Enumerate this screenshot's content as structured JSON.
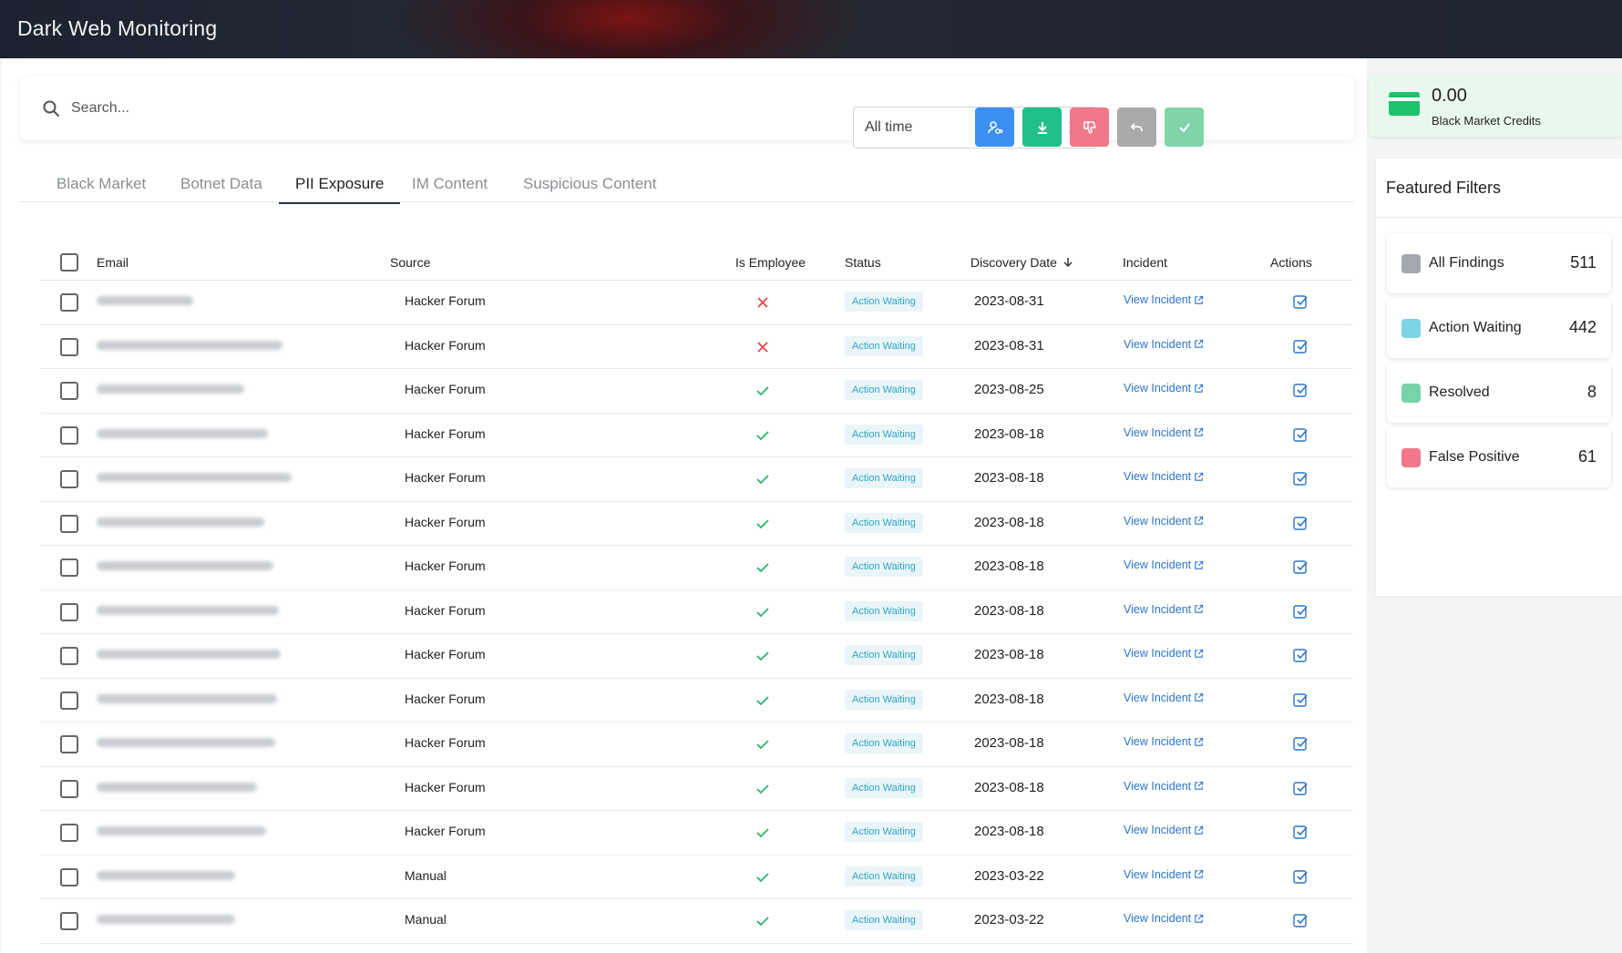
{
  "app": {
    "title": "Dark Web Monitoring"
  },
  "search": {
    "placeholder": "Search..."
  },
  "date_filter": {
    "value": "All time"
  },
  "toolbar": {
    "buttons": [
      {
        "name": "assign-button",
        "icon": "user-link-icon",
        "color": "#3b8ff3"
      },
      {
        "name": "download-button",
        "icon": "download-icon",
        "color": "#21c08b"
      },
      {
        "name": "false-positive-button",
        "icon": "thumbs-down-icon",
        "color": "#f0788a"
      },
      {
        "name": "undo-button",
        "icon": "undo-icon",
        "color": "#a9aaab"
      },
      {
        "name": "resolve-button",
        "icon": "check-icon",
        "color": "#7fd4a8"
      }
    ]
  },
  "tabs": [
    "Black Market",
    "Botnet Data",
    "PII Exposure",
    "IM Content",
    "Suspicious Content"
  ],
  "active_tab": "PII Exposure",
  "table": {
    "columns": [
      "Email",
      "Source",
      "Is Employee",
      "Status",
      "Discovery Date",
      "Incident",
      "Actions"
    ],
    "incident_link_label": "View Incident",
    "rows": [
      {
        "source": "Hacker Forum",
        "is_employee": false,
        "status": "Action Waiting",
        "date": "2023-08-31"
      },
      {
        "source": "Hacker Forum",
        "is_employee": false,
        "status": "Action Waiting",
        "date": "2023-08-31"
      },
      {
        "source": "Hacker Forum",
        "is_employee": true,
        "status": "Action Waiting",
        "date": "2023-08-25"
      },
      {
        "source": "Hacker Forum",
        "is_employee": true,
        "status": "Action Waiting",
        "date": "2023-08-18"
      },
      {
        "source": "Hacker Forum",
        "is_employee": true,
        "status": "Action Waiting",
        "date": "2023-08-18"
      },
      {
        "source": "Hacker Forum",
        "is_employee": true,
        "status": "Action Waiting",
        "date": "2023-08-18"
      },
      {
        "source": "Hacker Forum",
        "is_employee": true,
        "status": "Action Waiting",
        "date": "2023-08-18"
      },
      {
        "source": "Hacker Forum",
        "is_employee": true,
        "status": "Action Waiting",
        "date": "2023-08-18"
      },
      {
        "source": "Hacker Forum",
        "is_employee": true,
        "status": "Action Waiting",
        "date": "2023-08-18"
      },
      {
        "source": "Hacker Forum",
        "is_employee": true,
        "status": "Action Waiting",
        "date": "2023-08-18"
      },
      {
        "source": "Hacker Forum",
        "is_employee": true,
        "status": "Action Waiting",
        "date": "2023-08-18"
      },
      {
        "source": "Hacker Forum",
        "is_employee": true,
        "status": "Action Waiting",
        "date": "2023-08-18"
      },
      {
        "source": "Hacker Forum",
        "is_employee": true,
        "status": "Action Waiting",
        "date": "2023-08-18"
      },
      {
        "source": "Manual",
        "is_employee": true,
        "status": "Action Waiting",
        "date": "2023-03-22"
      },
      {
        "source": "Manual",
        "is_employee": true,
        "status": "Action Waiting",
        "date": "2023-03-22"
      }
    ]
  },
  "credits": {
    "amount": "0.00",
    "label": "Black Market Credits",
    "color": "#1ec36d"
  },
  "featured_filters": {
    "title": "Featured Filters",
    "items": [
      {
        "label": "All Findings",
        "count": "511",
        "color": "#a3a7ae"
      },
      {
        "label": "Action Waiting",
        "count": "442",
        "color": "#7dd3e6"
      },
      {
        "label": "Resolved",
        "count": "8",
        "color": "#77d4a8"
      },
      {
        "label": "False Positive",
        "count": "61",
        "color": "#f0788a"
      }
    ]
  }
}
